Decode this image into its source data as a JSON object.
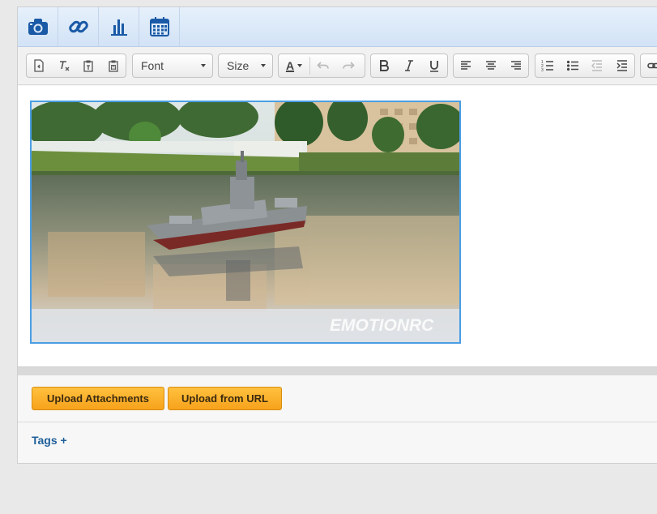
{
  "insert_toolbar": {
    "buttons": [
      {
        "icon": "camera-icon"
      },
      {
        "icon": "link-icon"
      },
      {
        "icon": "bar-chart-icon"
      },
      {
        "icon": "calendar-icon"
      }
    ],
    "icon_color": "#1a5aa6"
  },
  "format_toolbar": {
    "font_label": "Font",
    "size_label": "Size",
    "text_color_label": "A"
  },
  "editor": {
    "image_watermark": "EMOTIONRC"
  },
  "attachments": {
    "upload_label": "Upload Attachments",
    "upload_url_label": "Upload from URL"
  },
  "tags": {
    "label": "Tags +"
  },
  "colors": {
    "accent_blue": "#1f5f9a",
    "button_orange": "#f7a21c",
    "selection_border": "#4a9ee4"
  }
}
